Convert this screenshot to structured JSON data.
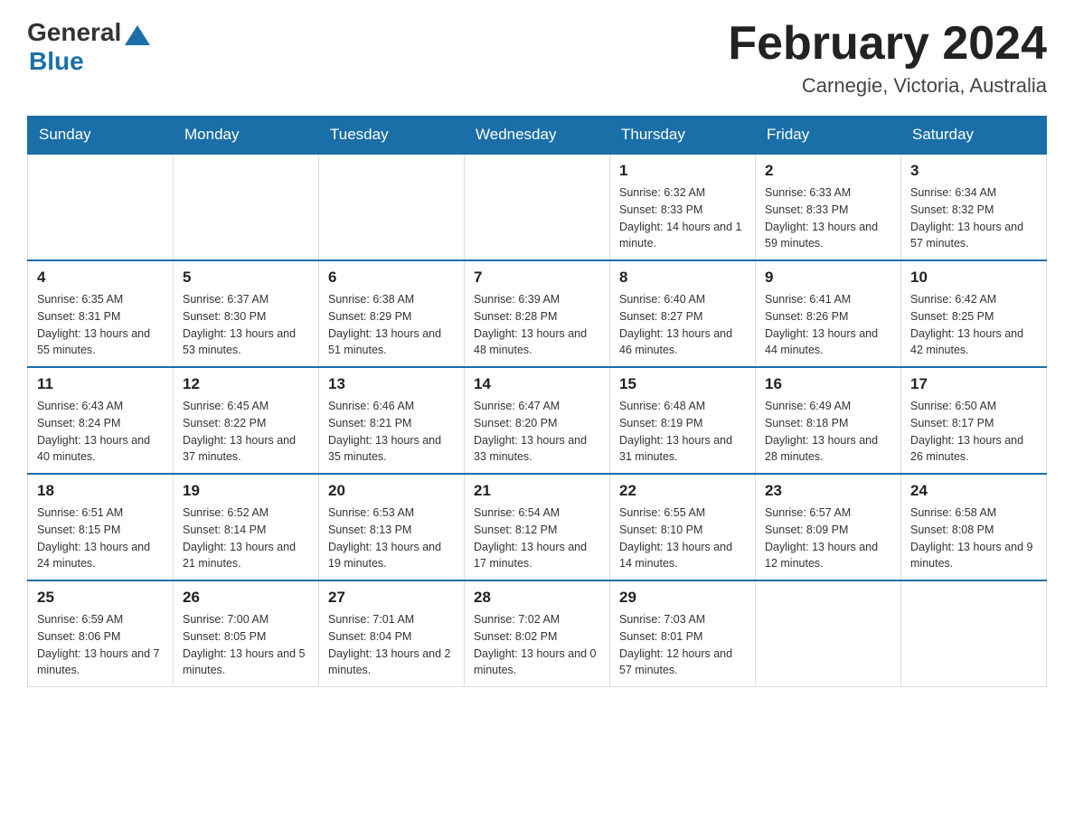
{
  "logo": {
    "general": "General",
    "blue": "Blue"
  },
  "title": "February 2024",
  "location": "Carnegie, Victoria, Australia",
  "days_of_week": [
    "Sunday",
    "Monday",
    "Tuesday",
    "Wednesday",
    "Thursday",
    "Friday",
    "Saturday"
  ],
  "weeks": [
    [
      {
        "day": "",
        "sunrise": "",
        "sunset": "",
        "daylight": ""
      },
      {
        "day": "",
        "sunrise": "",
        "sunset": "",
        "daylight": ""
      },
      {
        "day": "",
        "sunrise": "",
        "sunset": "",
        "daylight": ""
      },
      {
        "day": "",
        "sunrise": "",
        "sunset": "",
        "daylight": ""
      },
      {
        "day": "1",
        "sunrise": "Sunrise: 6:32 AM",
        "sunset": "Sunset: 8:33 PM",
        "daylight": "Daylight: 14 hours and 1 minute."
      },
      {
        "day": "2",
        "sunrise": "Sunrise: 6:33 AM",
        "sunset": "Sunset: 8:33 PM",
        "daylight": "Daylight: 13 hours and 59 minutes."
      },
      {
        "day": "3",
        "sunrise": "Sunrise: 6:34 AM",
        "sunset": "Sunset: 8:32 PM",
        "daylight": "Daylight: 13 hours and 57 minutes."
      }
    ],
    [
      {
        "day": "4",
        "sunrise": "Sunrise: 6:35 AM",
        "sunset": "Sunset: 8:31 PM",
        "daylight": "Daylight: 13 hours and 55 minutes."
      },
      {
        "day": "5",
        "sunrise": "Sunrise: 6:37 AM",
        "sunset": "Sunset: 8:30 PM",
        "daylight": "Daylight: 13 hours and 53 minutes."
      },
      {
        "day": "6",
        "sunrise": "Sunrise: 6:38 AM",
        "sunset": "Sunset: 8:29 PM",
        "daylight": "Daylight: 13 hours and 51 minutes."
      },
      {
        "day": "7",
        "sunrise": "Sunrise: 6:39 AM",
        "sunset": "Sunset: 8:28 PM",
        "daylight": "Daylight: 13 hours and 48 minutes."
      },
      {
        "day": "8",
        "sunrise": "Sunrise: 6:40 AM",
        "sunset": "Sunset: 8:27 PM",
        "daylight": "Daylight: 13 hours and 46 minutes."
      },
      {
        "day": "9",
        "sunrise": "Sunrise: 6:41 AM",
        "sunset": "Sunset: 8:26 PM",
        "daylight": "Daylight: 13 hours and 44 minutes."
      },
      {
        "day": "10",
        "sunrise": "Sunrise: 6:42 AM",
        "sunset": "Sunset: 8:25 PM",
        "daylight": "Daylight: 13 hours and 42 minutes."
      }
    ],
    [
      {
        "day": "11",
        "sunrise": "Sunrise: 6:43 AM",
        "sunset": "Sunset: 8:24 PM",
        "daylight": "Daylight: 13 hours and 40 minutes."
      },
      {
        "day": "12",
        "sunrise": "Sunrise: 6:45 AM",
        "sunset": "Sunset: 8:22 PM",
        "daylight": "Daylight: 13 hours and 37 minutes."
      },
      {
        "day": "13",
        "sunrise": "Sunrise: 6:46 AM",
        "sunset": "Sunset: 8:21 PM",
        "daylight": "Daylight: 13 hours and 35 minutes."
      },
      {
        "day": "14",
        "sunrise": "Sunrise: 6:47 AM",
        "sunset": "Sunset: 8:20 PM",
        "daylight": "Daylight: 13 hours and 33 minutes."
      },
      {
        "day": "15",
        "sunrise": "Sunrise: 6:48 AM",
        "sunset": "Sunset: 8:19 PM",
        "daylight": "Daylight: 13 hours and 31 minutes."
      },
      {
        "day": "16",
        "sunrise": "Sunrise: 6:49 AM",
        "sunset": "Sunset: 8:18 PM",
        "daylight": "Daylight: 13 hours and 28 minutes."
      },
      {
        "day": "17",
        "sunrise": "Sunrise: 6:50 AM",
        "sunset": "Sunset: 8:17 PM",
        "daylight": "Daylight: 13 hours and 26 minutes."
      }
    ],
    [
      {
        "day": "18",
        "sunrise": "Sunrise: 6:51 AM",
        "sunset": "Sunset: 8:15 PM",
        "daylight": "Daylight: 13 hours and 24 minutes."
      },
      {
        "day": "19",
        "sunrise": "Sunrise: 6:52 AM",
        "sunset": "Sunset: 8:14 PM",
        "daylight": "Daylight: 13 hours and 21 minutes."
      },
      {
        "day": "20",
        "sunrise": "Sunrise: 6:53 AM",
        "sunset": "Sunset: 8:13 PM",
        "daylight": "Daylight: 13 hours and 19 minutes."
      },
      {
        "day": "21",
        "sunrise": "Sunrise: 6:54 AM",
        "sunset": "Sunset: 8:12 PM",
        "daylight": "Daylight: 13 hours and 17 minutes."
      },
      {
        "day": "22",
        "sunrise": "Sunrise: 6:55 AM",
        "sunset": "Sunset: 8:10 PM",
        "daylight": "Daylight: 13 hours and 14 minutes."
      },
      {
        "day": "23",
        "sunrise": "Sunrise: 6:57 AM",
        "sunset": "Sunset: 8:09 PM",
        "daylight": "Daylight: 13 hours and 12 minutes."
      },
      {
        "day": "24",
        "sunrise": "Sunrise: 6:58 AM",
        "sunset": "Sunset: 8:08 PM",
        "daylight": "Daylight: 13 hours and 9 minutes."
      }
    ],
    [
      {
        "day": "25",
        "sunrise": "Sunrise: 6:59 AM",
        "sunset": "Sunset: 8:06 PM",
        "daylight": "Daylight: 13 hours and 7 minutes."
      },
      {
        "day": "26",
        "sunrise": "Sunrise: 7:00 AM",
        "sunset": "Sunset: 8:05 PM",
        "daylight": "Daylight: 13 hours and 5 minutes."
      },
      {
        "day": "27",
        "sunrise": "Sunrise: 7:01 AM",
        "sunset": "Sunset: 8:04 PM",
        "daylight": "Daylight: 13 hours and 2 minutes."
      },
      {
        "day": "28",
        "sunrise": "Sunrise: 7:02 AM",
        "sunset": "Sunset: 8:02 PM",
        "daylight": "Daylight: 13 hours and 0 minutes."
      },
      {
        "day": "29",
        "sunrise": "Sunrise: 7:03 AM",
        "sunset": "Sunset: 8:01 PM",
        "daylight": "Daylight: 12 hours and 57 minutes."
      },
      {
        "day": "",
        "sunrise": "",
        "sunset": "",
        "daylight": ""
      },
      {
        "day": "",
        "sunrise": "",
        "sunset": "",
        "daylight": ""
      }
    ]
  ]
}
